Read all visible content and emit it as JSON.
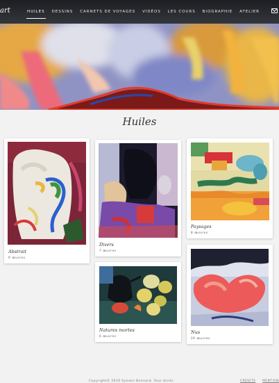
{
  "header": {
    "logo": "art",
    "nav": [
      {
        "label": "HUILES",
        "active": true
      },
      {
        "label": "DESSINS",
        "active": false
      },
      {
        "label": "CARNETS DE VOYAGES",
        "active": false
      },
      {
        "label": "VIDÉOS",
        "active": false
      },
      {
        "label": "LES COURS",
        "active": false
      },
      {
        "label": "BIOGRAPHIE",
        "active": false
      },
      {
        "label": "ATELIER",
        "active": false
      }
    ],
    "mail_icon": "mail-icon"
  },
  "hero": {
    "image": "abstract-painting-banner"
  },
  "page": {
    "title": "Huiles"
  },
  "galleries": [
    {
      "title": "Abstrait",
      "count": "9 œuvres"
    },
    {
      "title": "Divers",
      "count": "7 œuvres"
    },
    {
      "title": "Paysages",
      "count": "8 œuvres"
    },
    {
      "title": "Natures mortes",
      "count": "6 œuvres"
    },
    {
      "title": "Nus",
      "count": "20 œuvres"
    }
  ],
  "footer": {
    "copyright": "Copyright© 2019 Sylvain Bonnard, Tous droits",
    "links": [
      "CRÉDITS",
      "MENTION"
    ]
  }
}
